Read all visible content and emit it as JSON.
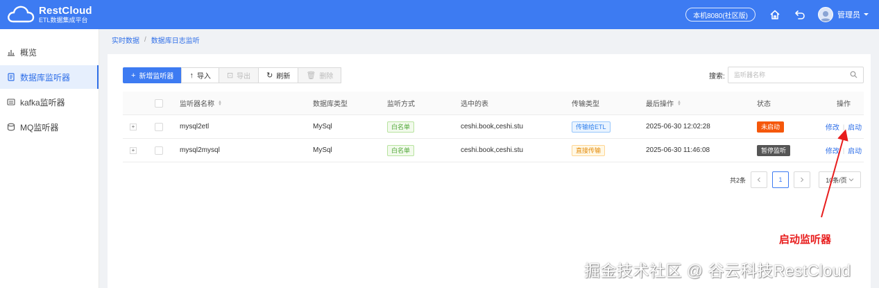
{
  "brand": {
    "title": "RestCloud",
    "subtitle": "ETL数据集成平台"
  },
  "header": {
    "env_badge": "本机8080(社区版)",
    "user": "管理员"
  },
  "sidebar": {
    "items": [
      {
        "label": "概览",
        "icon": "bar-chart-icon"
      },
      {
        "label": "数据库监听器",
        "icon": "document-icon"
      },
      {
        "label": "kafka监听器",
        "icon": "list-icon"
      },
      {
        "label": "MQ监听器",
        "icon": "database-icon"
      }
    ],
    "active_index": 1
  },
  "breadcrumb": {
    "items": [
      "实时数据",
      "数据库日志监听"
    ]
  },
  "toolbar": {
    "add": "新增监听器",
    "import": "导入",
    "export": "导出",
    "refresh": "刷新",
    "delete": "删除"
  },
  "search": {
    "label": "搜索:",
    "placeholder": "监听器名称",
    "value": ""
  },
  "table": {
    "headers": [
      "监听器名称",
      "数据库类型",
      "监听方式",
      "选中的表",
      "传输类型",
      "最后操作",
      "状态",
      "操作"
    ],
    "rows": [
      {
        "expand": "+",
        "name": "mysql2etl",
        "db_type": "MySql",
        "mode": "白名单",
        "tables": "ceshi.book,ceshi.stu",
        "transfer": "传输给ETL",
        "last_op": "2025-06-30 12:02:28",
        "status": "未启动",
        "edit": "修改",
        "start": "启动"
      },
      {
        "expand": "+",
        "name": "mysql2mysql",
        "db_type": "MySql",
        "mode": "白名单",
        "tables": "ceshi.book,ceshi.stu",
        "transfer": "直接传输",
        "last_op": "2025-06-30 11:46:08",
        "status": "暂停监听",
        "edit": "修改",
        "start": "启动"
      }
    ]
  },
  "pagination": {
    "total": "共2条",
    "current": "1",
    "page_size": "10条/页"
  },
  "annotation": {
    "text": "启动监听器"
  },
  "watermark": "掘金技术社区 @ 谷云科技RestCloud",
  "colors": {
    "header_bg": "#3d7bf2",
    "primary": "#2f6fe8",
    "status_stopped": "#f5570a",
    "status_paused": "#555555",
    "annotation": "#e81c1c"
  }
}
